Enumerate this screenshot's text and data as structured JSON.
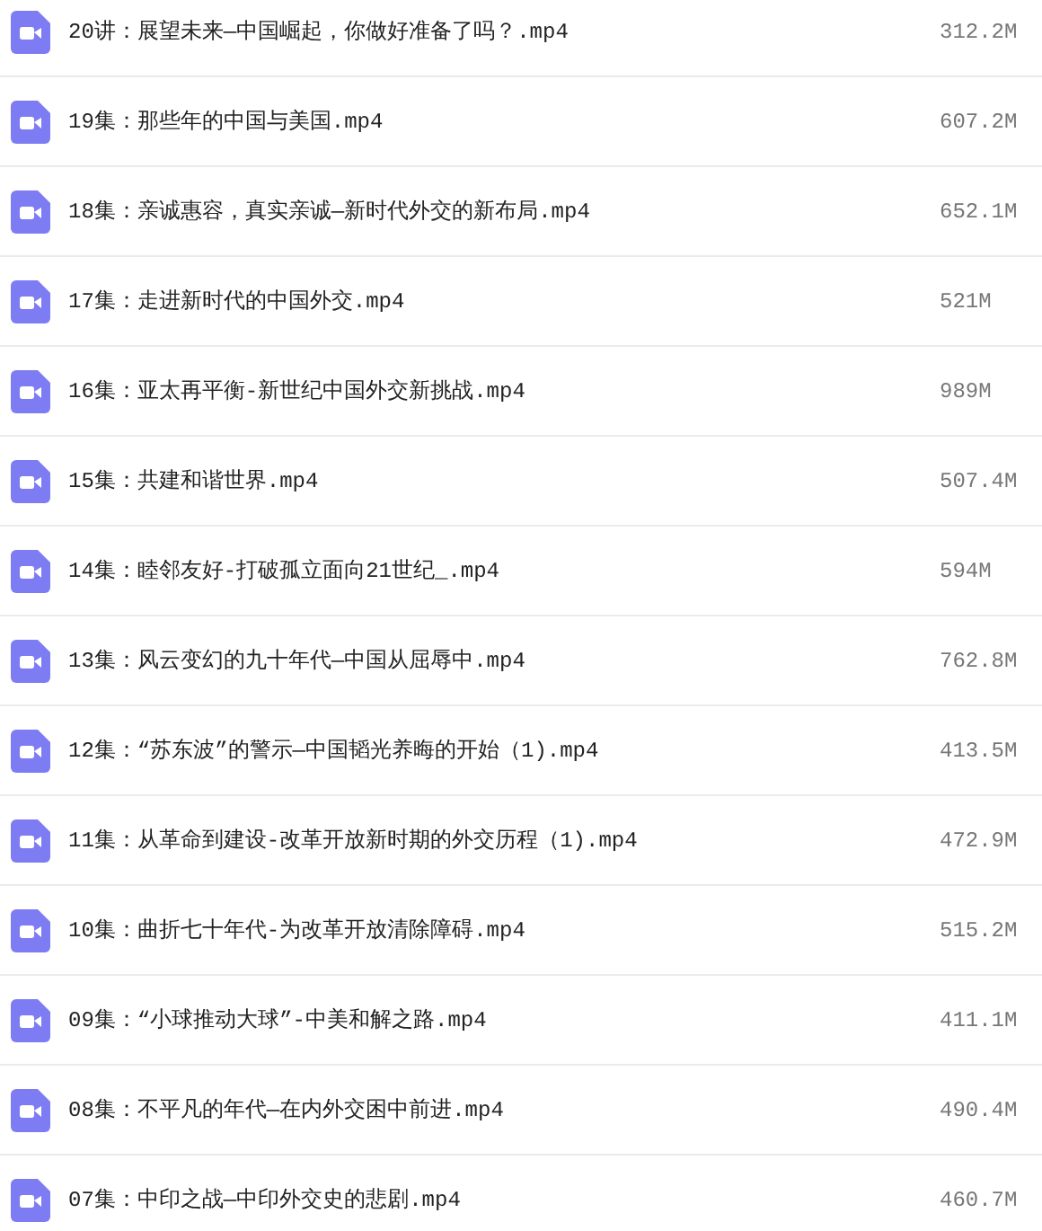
{
  "files": [
    {
      "name": "20讲：展望未来—中国崛起，你做好准备了吗？.mp4",
      "size": "312.2M"
    },
    {
      "name": "19集：那些年的中国与美国.mp4",
      "size": "607.2M"
    },
    {
      "name": "18集：亲诚惠容，真实亲诚—新时代外交的新布局.mp4",
      "size": "652.1M"
    },
    {
      "name": "17集：走进新时代的中国外交.mp4",
      "size": "521M"
    },
    {
      "name": "16集：亚太再平衡-新世纪中国外交新挑战.mp4",
      "size": "989M"
    },
    {
      "name": "15集：共建和谐世界.mp4",
      "size": "507.4M"
    },
    {
      "name": "14集：睦邻友好-打破孤立面向21世纪_.mp4",
      "size": "594M"
    },
    {
      "name": "13集：风云变幻的九十年代—中国从屈辱中.mp4",
      "size": "762.8M"
    },
    {
      "name": "12集：“苏东波”的警示—中国韬光养晦的开始（1).mp4",
      "size": "413.5M"
    },
    {
      "name": "11集：从革命到建设-改革开放新时期的外交历程（1).mp4",
      "size": "472.9M"
    },
    {
      "name": "10集：曲折七十年代-为改革开放清除障碍.mp4",
      "size": "515.2M"
    },
    {
      "name": "09集：“小球推动大球”-中美和解之路.mp4",
      "size": "411.1M"
    },
    {
      "name": "08集：不平凡的年代—在内外交困中前进.mp4",
      "size": "490.4M"
    },
    {
      "name": "07集：中印之战—中印外交史的悲剧.mp4",
      "size": "460.7M"
    }
  ]
}
